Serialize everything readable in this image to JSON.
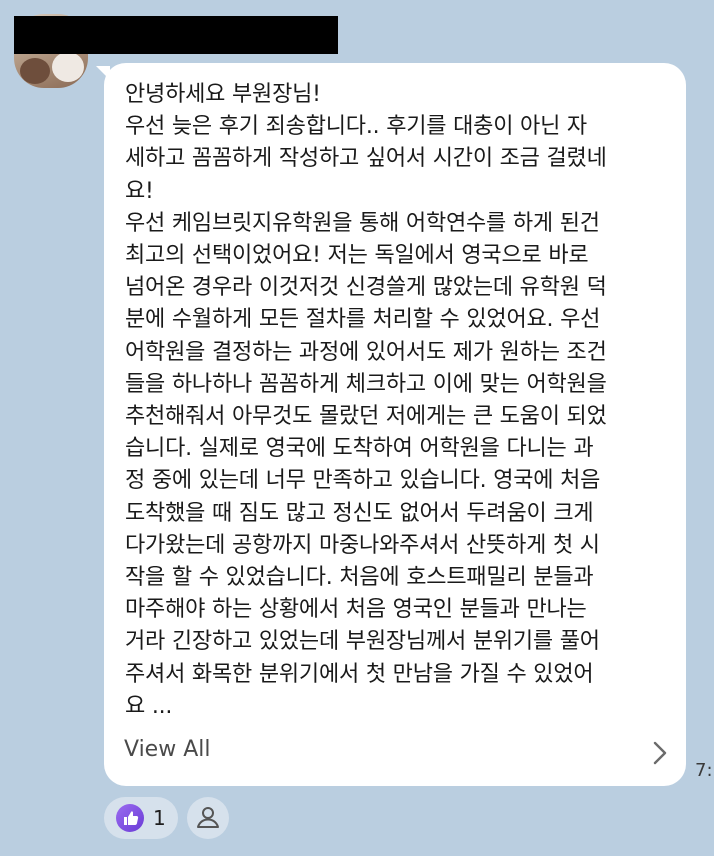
{
  "message": {
    "lines": [
      "안녕하세요 부원장님!",
      "우선 늦은 후기 죄송합니다..  후기를 대충이 아닌 자",
      "세하고 꼼꼼하게 작성하고 싶어서 시간이 조금 걸렸네",
      "요!",
      "우선 케임브릿지유학원을 통해 어학연수를 하게 된건",
      "최고의 선택이었어요! 저는 독일에서 영국으로 바로",
      "넘어온 경우라 이것저것 신경쓸게 많았는데 유학원 덕",
      "분에 수월하게 모든 절차를 처리할 수 있었어요. 우선",
      "어학원을 결정하는 과정에 있어서도 제가 원하는 조건",
      "들을 하나하나 꼼꼼하게 체크하고 이에 맞는 어학원을",
      "추천해줘서 아무것도 몰랐던 저에게는 큰 도움이 되었",
      "습니다. 실제로 영국에 도착하여 어학원을 다니는 과",
      "정 중에 있는데 너무 만족하고 있습니다. 영국에 처음",
      "도착했을 때 짐도 많고 정신도 없어서 두려움이 크게",
      "다가왔는데 공항까지 마중나와주셔서 산뜻하게 첫 시",
      "작을 할 수 있었습니다. 처음에 호스트패밀리 분들과",
      "마주해야 하는 상황에서 처음 영국인 분들과 만나는",
      "거라 긴장하고 있었는데 부원장님께서 분위기를 풀어",
      "주셔서 화목한 분위기에서 첫 만남을 가질 수 있었어",
      "요 ..."
    ],
    "view_all_label": "View All",
    "timestamp": "7:"
  },
  "reactions": {
    "like_count": "1",
    "like_icon": "thumbs-up-icon",
    "add_icon": "person-icon"
  },
  "colors": {
    "background": "#bacee0",
    "bubble": "#ffffff",
    "like_badge": "#7b4fe4"
  }
}
